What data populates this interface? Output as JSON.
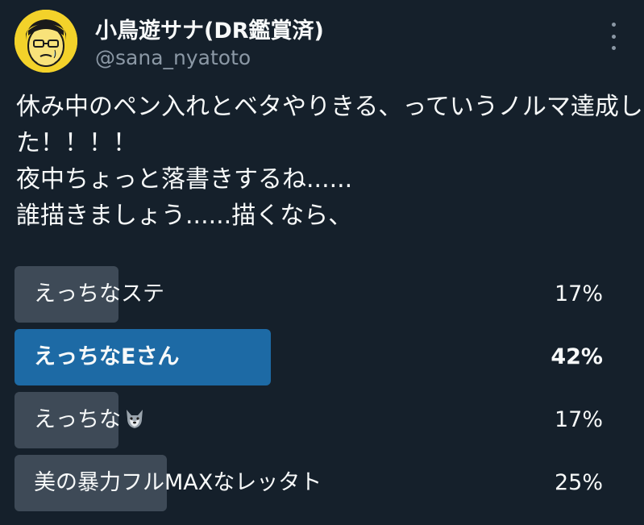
{
  "user": {
    "display_name": "小鳥遊サナ(DR鑑賞済)",
    "handle": "@sana_nyatoto",
    "avatar_icon": "avatar-icon"
  },
  "tweet": {
    "lines": [
      "休み中のペン入れとベタやりきる、っていうノルマ達成し",
      "た！！！！",
      "夜中ちょっと落書きするね......",
      "誰描きましょう......描くなら、"
    ]
  },
  "poll": {
    "options": [
      {
        "label": "えっちなステ",
        "percent": 17,
        "percent_text": "17%",
        "winner": false
      },
      {
        "label": "えっちなEさん",
        "percent": 42,
        "percent_text": "42%",
        "winner": true
      },
      {
        "label": "えっちな",
        "percent": 17,
        "percent_text": "17%",
        "winner": false,
        "icon": "wolf-icon"
      },
      {
        "label": "美の暴力フルMAXなレッタト",
        "percent": 25,
        "percent_text": "25%",
        "winner": false
      }
    ]
  },
  "colors": {
    "background": "#15202b",
    "bar": "#3e4a57",
    "winner_bar": "#1d6aa5",
    "secondary_text": "#8b98a5"
  }
}
